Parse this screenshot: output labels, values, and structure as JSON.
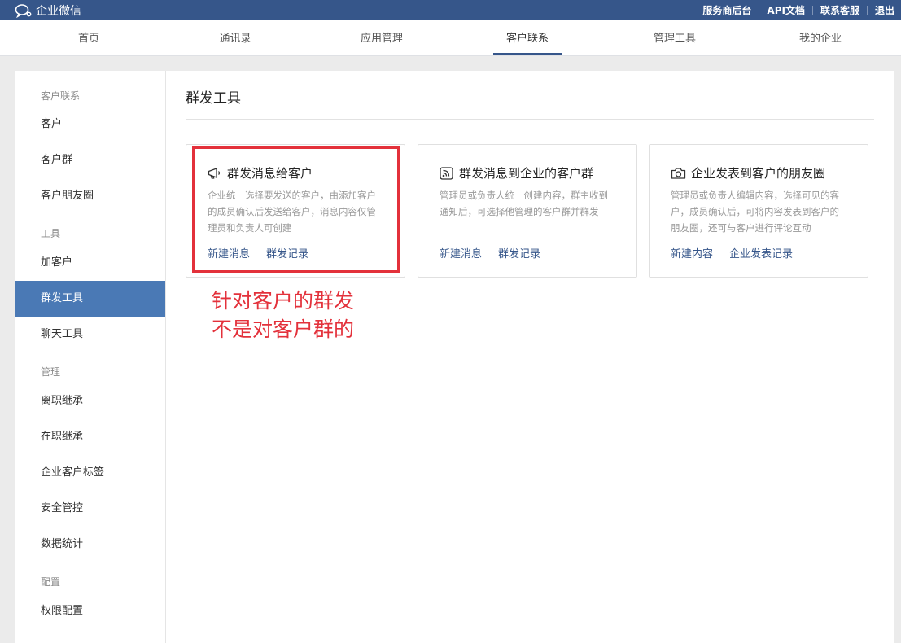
{
  "topbar": {
    "brand": "企业微信",
    "links": [
      "服务商后台",
      "API文档",
      "联系客服",
      "退出"
    ]
  },
  "nav": {
    "tabs": [
      "首页",
      "通讯录",
      "应用管理",
      "客户联系",
      "管理工具",
      "我的企业"
    ],
    "active": "客户联系"
  },
  "sidebar": {
    "sections": [
      {
        "heading": "客户联系",
        "items": [
          "客户",
          "客户群",
          "客户朋友圈"
        ]
      },
      {
        "heading": "工具",
        "items": [
          "加客户",
          "群发工具",
          "聊天工具"
        ]
      },
      {
        "heading": "管理",
        "items": [
          "离职继承",
          "在职继承",
          "企业客户标签",
          "安全管控",
          "数据统计"
        ]
      },
      {
        "heading": "配置",
        "items": [
          "权限配置"
        ]
      }
    ],
    "active_item": "群发工具"
  },
  "content": {
    "title": "群发工具",
    "cards": [
      {
        "icon": "megaphone-icon",
        "title": "群发消息给客户",
        "desc": "企业统一选择要发送的客户，由添加客户的成员确认后发送给客户，消息内容仅管理员和负责人可创建",
        "actions": [
          "新建消息",
          "群发记录"
        ]
      },
      {
        "icon": "broadcast-icon",
        "title": "群发消息到企业的客户群",
        "desc": "管理员或负责人统一创建内容，群主收到通知后，可选择他管理的客户群并群发",
        "actions": [
          "新建消息",
          "群发记录"
        ]
      },
      {
        "icon": "camera-icon",
        "title": "企业发表到客户的朋友圈",
        "desc": "管理员或负责人编辑内容，选择可见的客户，成员确认后，可将内容发表到客户的朋友圈，还可与客户进行评论互动",
        "actions": [
          "新建内容",
          "企业发表记录"
        ]
      }
    ]
  },
  "annotation": {
    "lines": [
      "针对客户的群发",
      "不是对客户群的"
    ],
    "color": "#e3313b"
  },
  "colors": {
    "topbar": "#36568a",
    "accent": "#4a79b5",
    "link": "#36568a"
  }
}
